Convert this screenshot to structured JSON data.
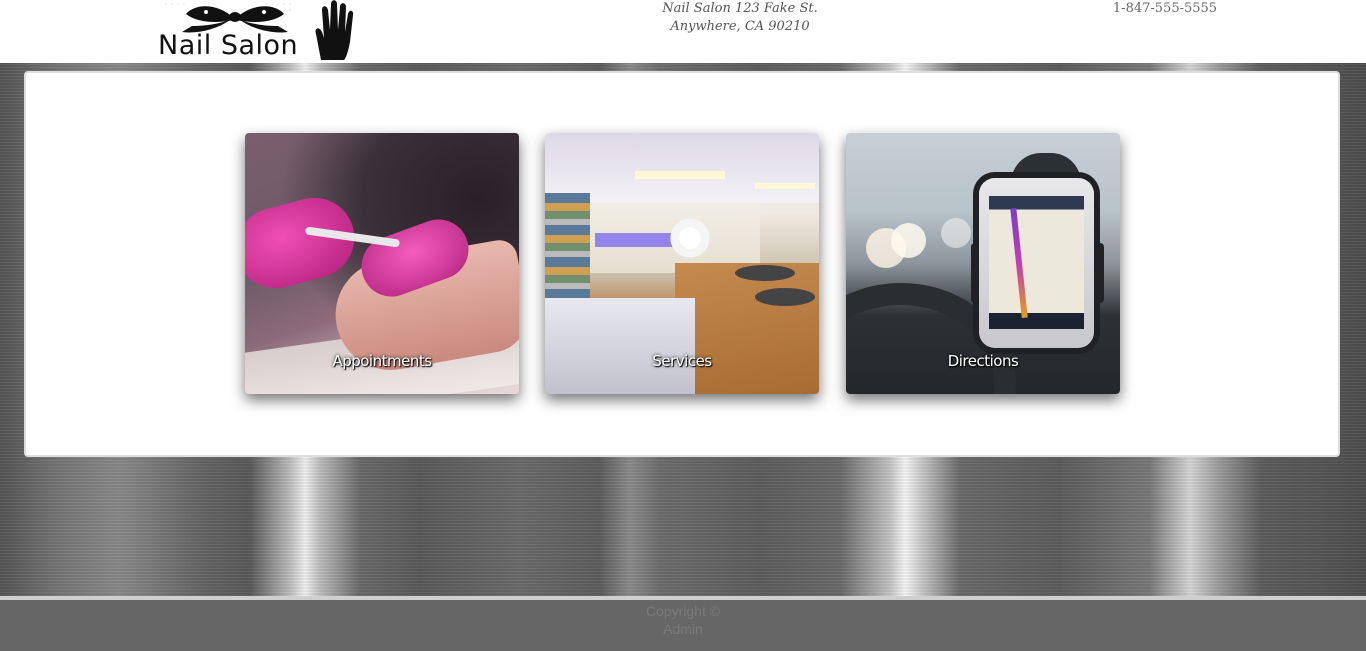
{
  "header": {
    "logo_text": "Nail Salon",
    "address_line1": "Nail Salon 123 Fake St.",
    "address_line2": "Anywhere, CA 90210",
    "phone": "1-847-555-5555"
  },
  "cards": [
    {
      "label": "Appointments",
      "image": "manicure-photo"
    },
    {
      "label": "Services",
      "image": "salon-interior-photo"
    },
    {
      "label": "Directions",
      "image": "phone-gps-photo"
    }
  ],
  "footer": {
    "copyright": "Copyright ©",
    "author": "Admin"
  },
  "colors": {
    "header_bg": "#ffffff",
    "panel_bg": "#ffffff",
    "footer_bg": "#666666",
    "card_label": "#ffffff"
  }
}
